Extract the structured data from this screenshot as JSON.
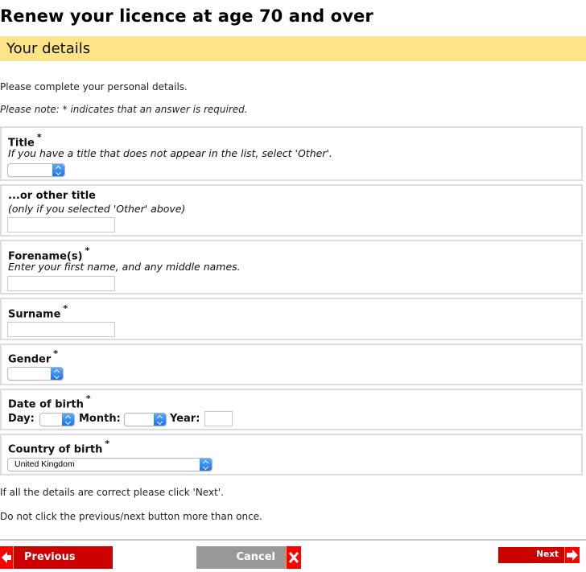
{
  "page": {
    "title": "Renew your licence at age 70 and over",
    "section": "Your details",
    "intro": "Please complete your personal details.",
    "note": "Please note: * indicates that an answer is required."
  },
  "fields": {
    "title": {
      "label": "Title",
      "required_marker": "*",
      "hint": "If you have a title that does not appear in the list, select 'Other'.",
      "selected": ""
    },
    "other_title": {
      "label": "...or other title",
      "hint": "(only if you selected 'Other' above)",
      "value": ""
    },
    "forenames": {
      "label": "Forename(s)",
      "required_marker": "*",
      "hint": "Enter your first name, and any middle names.",
      "value": ""
    },
    "surname": {
      "label": "Surname",
      "required_marker": "*",
      "value": ""
    },
    "gender": {
      "label": "Gender",
      "required_marker": "*",
      "selected": ""
    },
    "dob": {
      "label": "Date of birth",
      "required_marker": "*",
      "day_label": "Day:",
      "month_label": "Month:",
      "year_label": "Year:",
      "day": "",
      "month": "",
      "year": ""
    },
    "country": {
      "label": "Country of birth",
      "required_marker": "*",
      "selected": "United Kingdom"
    }
  },
  "footer": {
    "confirm_text": "If all the details are correct please click 'Next'.",
    "warning_text": "Do not click the previous/next button more than once."
  },
  "buttons": {
    "previous": "Previous",
    "cancel": "Cancel",
    "next": "Next"
  },
  "colors": {
    "section_bar": "#fde487",
    "button_red": "#cc0000",
    "button_grey": "#999999",
    "icon_red": "#ff0000"
  }
}
